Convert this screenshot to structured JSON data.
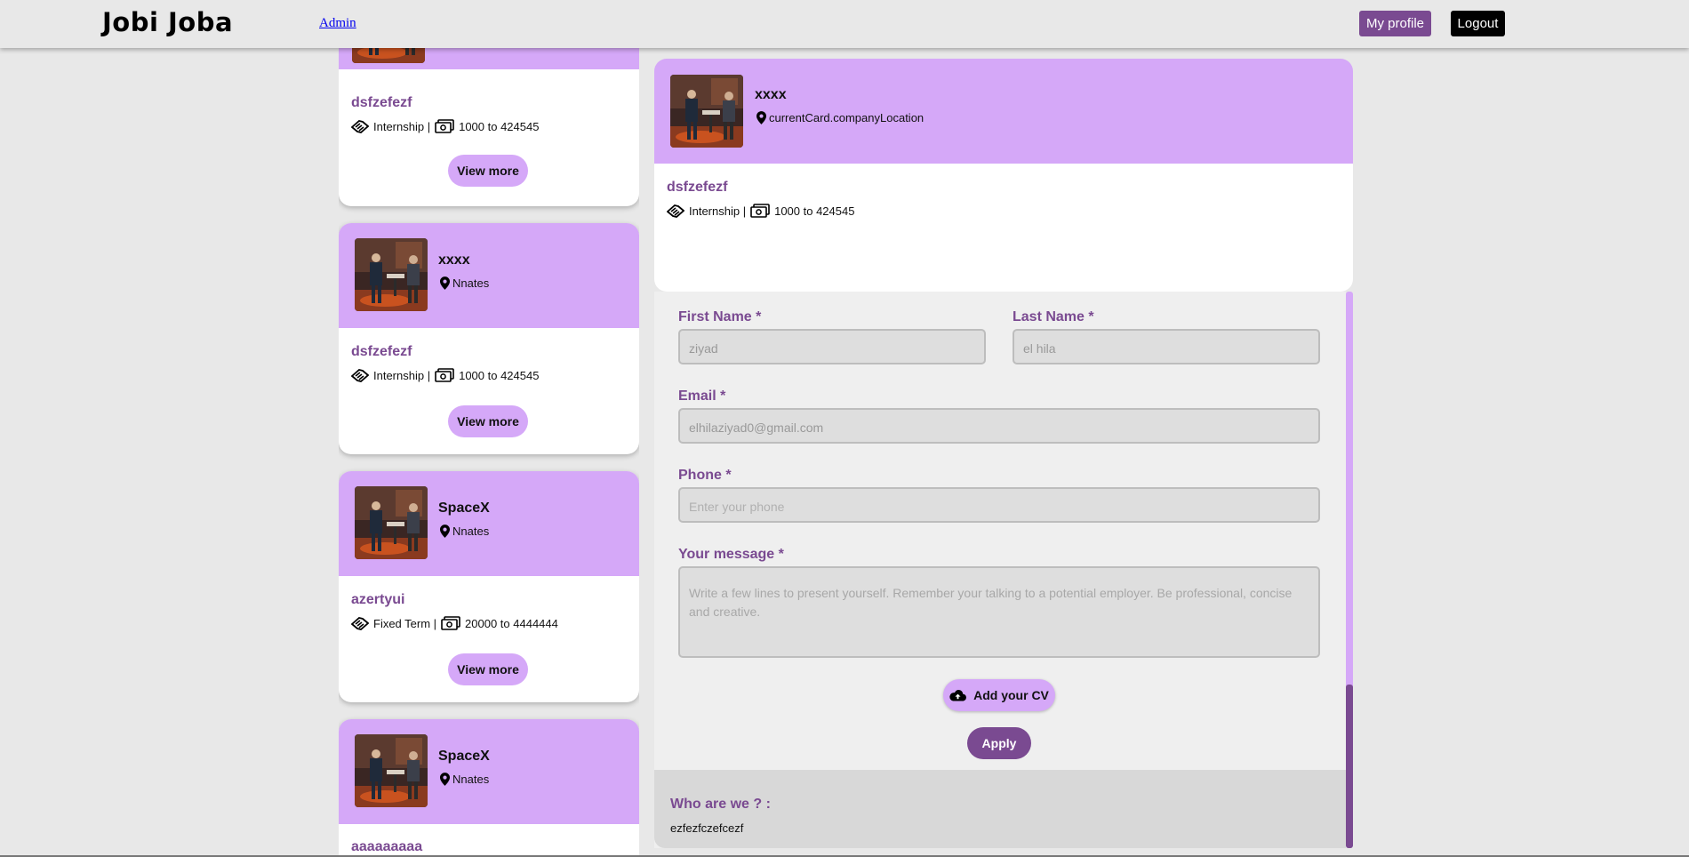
{
  "header": {
    "logo": "Jobi Joba",
    "admin_link": "Admin",
    "my_profile": "My profile",
    "logout": "Logout"
  },
  "jobs": [
    {
      "title": "dsfzefezf",
      "contract": "Internship |",
      "salary": "1000 to 424545",
      "view_more": "View more"
    },
    {
      "company": "xxxx",
      "location": "Nnates",
      "title": "dsfzefezf",
      "contract": "Internship |",
      "salary": "1000 to 424545",
      "view_more": "View more"
    },
    {
      "company": "SpaceX",
      "location": "Nnates",
      "title": "azertyui",
      "contract": "Fixed Term |",
      "salary": "20000 to 4444444",
      "view_more": "View more"
    },
    {
      "company": "SpaceX",
      "location": "Nnates",
      "title": "aaaaaaaaa"
    }
  ],
  "detail": {
    "company": "xxxx",
    "location": "currentCard.companyLocation",
    "title": "dsfzefezf",
    "contract": "Internship |",
    "salary": "1000 to 424545"
  },
  "form": {
    "first_name_label": "First Name *",
    "first_name_value": "ziyad",
    "last_name_label": "Last Name *",
    "last_name_value": "el hila",
    "email_label": "Email *",
    "email_value": "elhilaziyad0@gmail.com",
    "phone_label": "Phone *",
    "phone_placeholder": "Enter your phone",
    "message_label": "Your message *",
    "message_placeholder": "Write a few lines to present yourself. Remember your talking to a potential employer. Be professional, concise and creative.",
    "add_cv": "Add your CV",
    "apply": "Apply"
  },
  "about": {
    "title": "Who are we ? :",
    "text": "ezfezfczefcezf"
  },
  "colors": {
    "accent": "#7a4a91",
    "card_header": "#d5a8f8",
    "background": "#e8e8e8"
  },
  "icons": [
    "map-pin-icon",
    "contract-handshake-icon",
    "money-bill-icon",
    "cloud-upload-icon"
  ]
}
